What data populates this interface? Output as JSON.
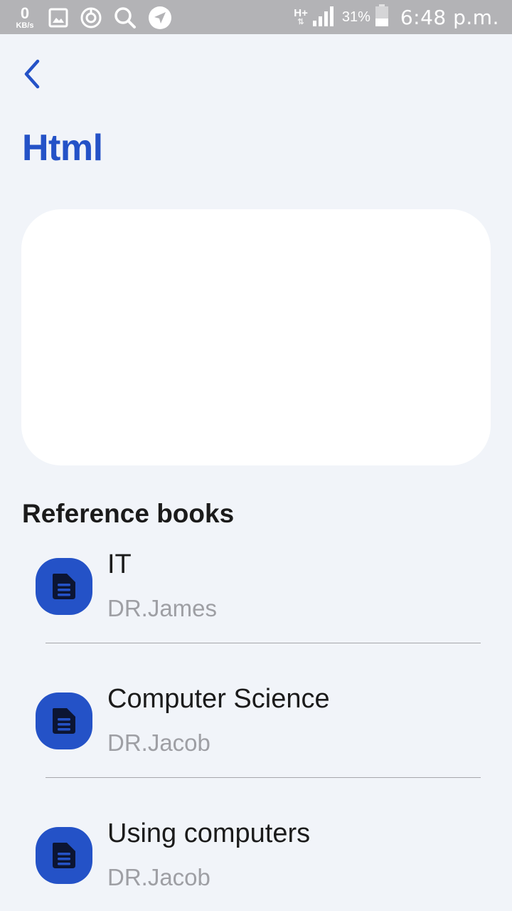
{
  "status_bar": {
    "net_speed_value": "0",
    "net_speed_unit": "KB/s",
    "network_type": "H+",
    "network_arrows": "⇅",
    "battery_percent": "31%",
    "time": "6:48 p.m.",
    "icons": [
      "gallery-icon",
      "sync-icon",
      "search-icon",
      "navigation-icon",
      "signal-icon",
      "battery-icon"
    ]
  },
  "header": {
    "back_icon": "chevron-left-icon",
    "title": "Html"
  },
  "section": {
    "title": "Reference books"
  },
  "books": [
    {
      "title": "IT",
      "author": "DR.James",
      "icon": "document-icon"
    },
    {
      "title": "Computer Science",
      "author": "DR.Jacob",
      "icon": "document-icon"
    },
    {
      "title": "Using computers",
      "author": "DR.Jacob",
      "icon": "document-icon"
    }
  ],
  "colors": {
    "accent": "#2452c7",
    "background": "#f1f4f9",
    "card": "#ffffff",
    "status_bar": "#b3b3b6",
    "secondary_text": "#9e9fa4",
    "icon_glyph": "#0c1533"
  }
}
